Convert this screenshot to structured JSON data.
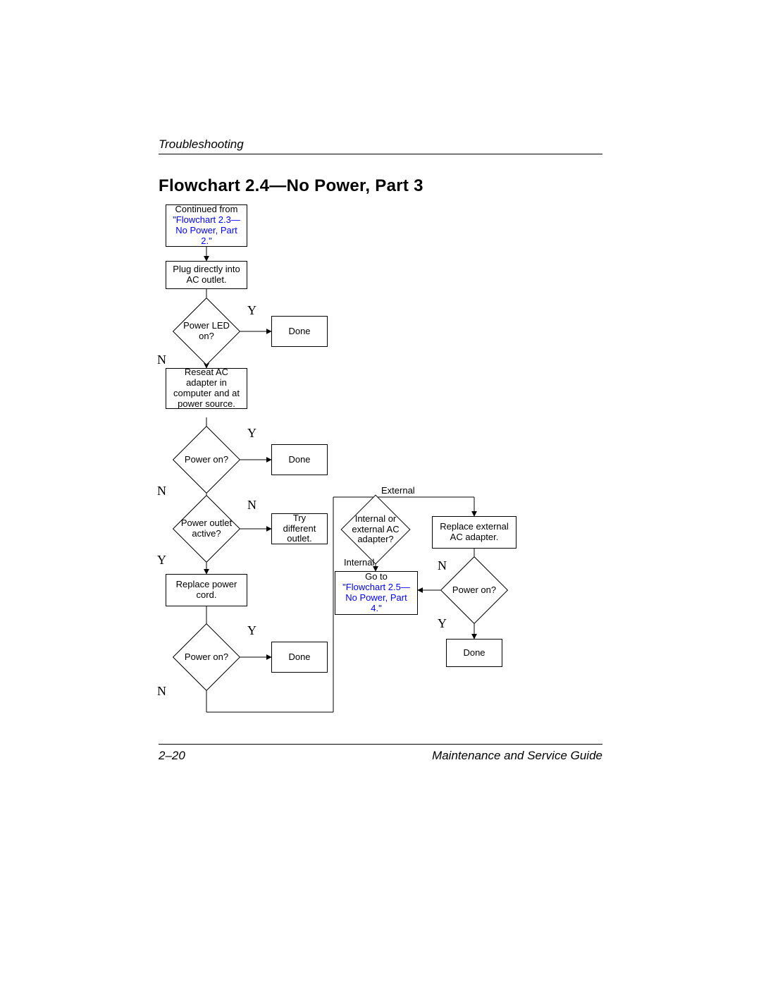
{
  "header": {
    "section": "Troubleshooting"
  },
  "title": "Flowchart 2.4—No Power, Part 3",
  "footer": {
    "page": "2–20",
    "guide": "Maintenance and Service Guide"
  },
  "labels": {
    "Y": "Y",
    "N": "N",
    "Internal": "Internal",
    "External": "External"
  },
  "nodes": {
    "cont_from_prefix": "Continued from",
    "cont_from_link": "\"Flowchart 2.3—No Power, Part 2.\"",
    "plug": "Plug directly into AC outlet.",
    "led": "Power LED on?",
    "done1": "Done",
    "reseat": "Reseat AC adapter in computer and at power source.",
    "poweron1": "Power on?",
    "done2": "Done",
    "outlet": "Power outlet active?",
    "tryout": "Try different outlet.",
    "replcord": "Replace power cord.",
    "poweron2": "Power on?",
    "done3": "Done",
    "intext": "Internal or external AC adapter?",
    "replext": "Replace external AC adapter.",
    "goto_prefix": "Go to",
    "goto_link": "\"Flowchart 2.5—No Power, Part 4.\"",
    "poweron3": "Power on?",
    "done4": "Done"
  },
  "chart_data": {
    "type": "flowchart",
    "title": "Flowchart 2.4—No Power, Part 3",
    "nodes": [
      {
        "id": "start",
        "shape": "rect",
        "text": "Continued from \"Flowchart 2.3—No Power, Part 2.\"",
        "link": "Flowchart 2.3—No Power, Part 2."
      },
      {
        "id": "plug",
        "shape": "rect",
        "text": "Plug directly into AC outlet."
      },
      {
        "id": "led",
        "shape": "diamond",
        "text": "Power LED on?"
      },
      {
        "id": "done1",
        "shape": "rect",
        "text": "Done"
      },
      {
        "id": "reseat",
        "shape": "rect",
        "text": "Reseat AC adapter in computer and at power source."
      },
      {
        "id": "poweron1",
        "shape": "diamond",
        "text": "Power on?"
      },
      {
        "id": "done2",
        "shape": "rect",
        "text": "Done"
      },
      {
        "id": "outlet",
        "shape": "diamond",
        "text": "Power outlet active?"
      },
      {
        "id": "tryout",
        "shape": "rect",
        "text": "Try different outlet."
      },
      {
        "id": "replcord",
        "shape": "rect",
        "text": "Replace power cord."
      },
      {
        "id": "poweron2",
        "shape": "diamond",
        "text": "Power on?"
      },
      {
        "id": "done3",
        "shape": "rect",
        "text": "Done"
      },
      {
        "id": "intext",
        "shape": "diamond",
        "text": "Internal or external AC adapter?"
      },
      {
        "id": "replext",
        "shape": "rect",
        "text": "Replace external AC adapter."
      },
      {
        "id": "goto",
        "shape": "rect",
        "text": "Go to \"Flowchart 2.5—No Power, Part 4.\"",
        "link": "Flowchart 2.5—No Power, Part 4."
      },
      {
        "id": "poweron3",
        "shape": "diamond",
        "text": "Power on?"
      },
      {
        "id": "done4",
        "shape": "rect",
        "text": "Done"
      }
    ],
    "edges": [
      {
        "from": "start",
        "to": "plug",
        "label": ""
      },
      {
        "from": "plug",
        "to": "led",
        "label": ""
      },
      {
        "from": "led",
        "to": "done1",
        "label": "Y"
      },
      {
        "from": "led",
        "to": "reseat",
        "label": "N"
      },
      {
        "from": "reseat",
        "to": "poweron1",
        "label": ""
      },
      {
        "from": "poweron1",
        "to": "done2",
        "label": "Y"
      },
      {
        "from": "poweron1",
        "to": "outlet",
        "label": "N"
      },
      {
        "from": "outlet",
        "to": "tryout",
        "label": "N"
      },
      {
        "from": "outlet",
        "to": "replcord",
        "label": "Y"
      },
      {
        "from": "replcord",
        "to": "poweron2",
        "label": ""
      },
      {
        "from": "poweron2",
        "to": "done3",
        "label": "Y"
      },
      {
        "from": "poweron2",
        "to": "intext",
        "label": "N"
      },
      {
        "from": "tryout",
        "to": "intext",
        "label": ""
      },
      {
        "from": "intext",
        "to": "replext",
        "label": "External"
      },
      {
        "from": "intext",
        "to": "goto",
        "label": "Internal"
      },
      {
        "from": "replext",
        "to": "poweron3",
        "label": ""
      },
      {
        "from": "poweron3",
        "to": "done4",
        "label": "Y"
      },
      {
        "from": "poweron3",
        "to": "goto",
        "label": "N"
      }
    ]
  }
}
